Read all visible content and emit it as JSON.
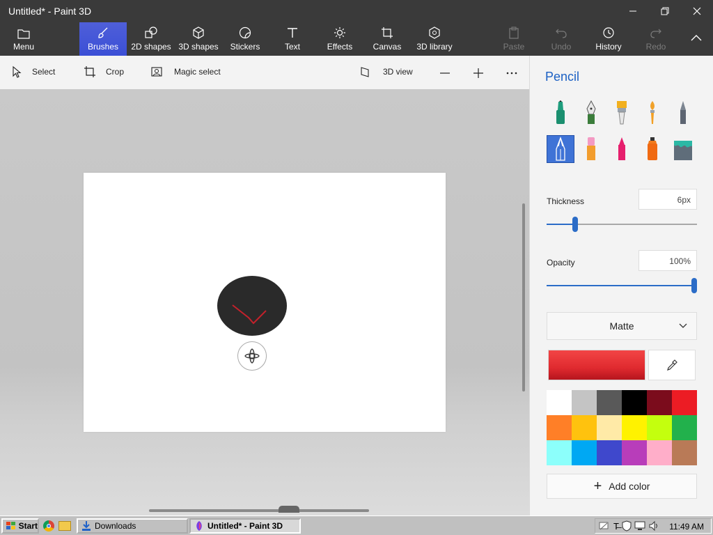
{
  "window": {
    "title": "Untitled* - Paint 3D"
  },
  "toolbar": {
    "menu": "Menu",
    "brushes": "Brushes",
    "shapes2d": "2D shapes",
    "shapes3d": "3D shapes",
    "stickers": "Stickers",
    "text": "Text",
    "effects": "Effects",
    "canvas": "Canvas",
    "library3d": "3D library",
    "paste": "Paste",
    "undo": "Undo",
    "history": "History",
    "redo": "Redo"
  },
  "subtoolbar": {
    "select": "Select",
    "crop": "Crop",
    "magic_select": "Magic select",
    "view3d": "3D view"
  },
  "panel": {
    "title": "Pencil",
    "thickness_label": "Thickness",
    "thickness_value": "6px",
    "thickness_level": 0.18,
    "opacity_label": "Opacity",
    "opacity_value": "100%",
    "opacity_level": 1.0,
    "finish": "Matte",
    "current_color": "#e02a2f",
    "add_color": "Add color",
    "palette": [
      "#ffffff",
      "#c4c4c4",
      "#595959",
      "#000000",
      "#7b0c1c",
      "#ec1c24",
      "#ff7f27",
      "#ffc20e",
      "#ffeaa7",
      "#fff200",
      "#c4ff0e",
      "#22b14c",
      "#8cfffb",
      "#00a8f3",
      "#3f48cc",
      "#b83dba",
      "#ffaec9",
      "#b97a57"
    ]
  },
  "taskbar": {
    "start": "Start",
    "downloads": "Downloads",
    "paint3d": "Untitled* - Paint 3D",
    "clock": "11:49 AM"
  }
}
